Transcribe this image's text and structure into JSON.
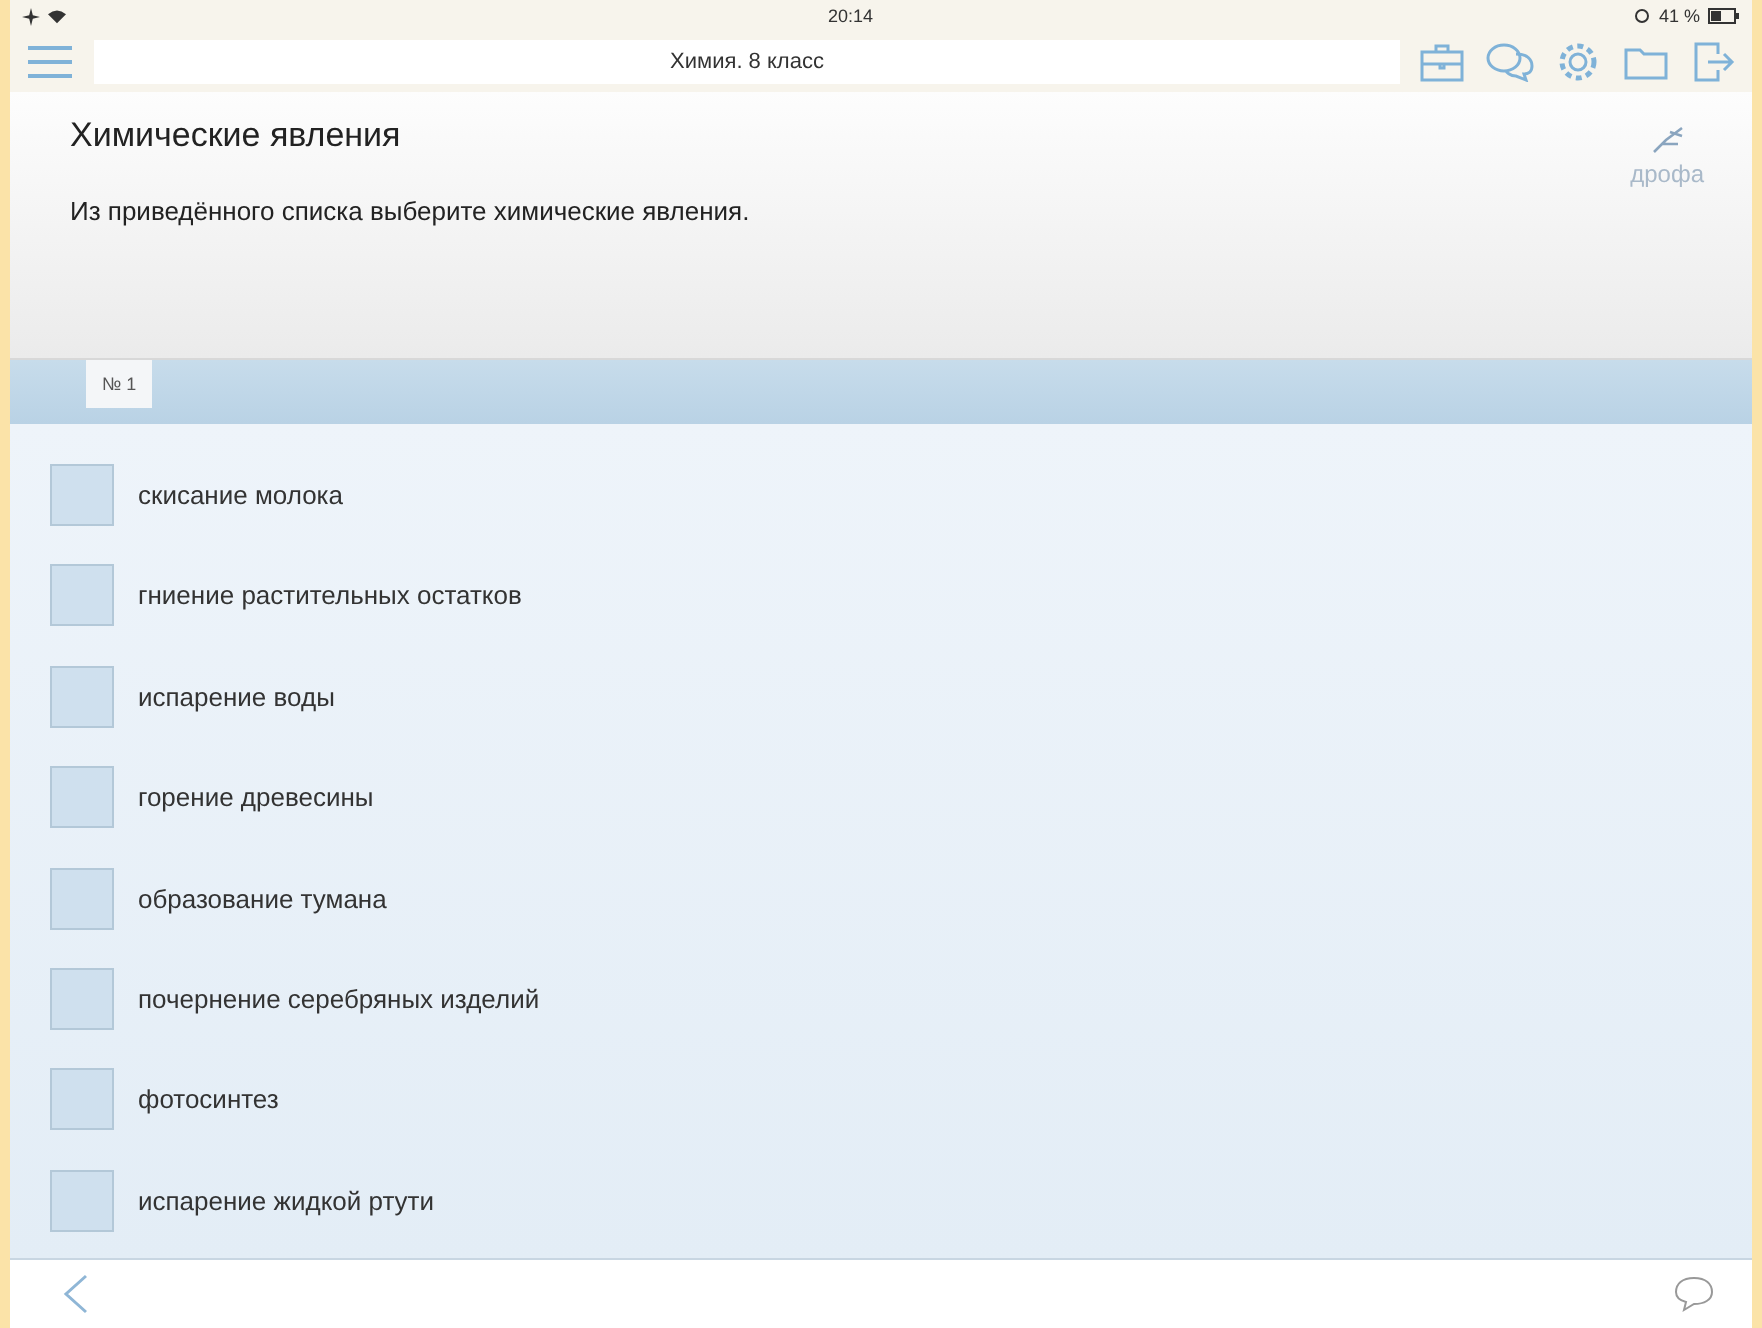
{
  "status_bar": {
    "time": "20:14",
    "battery": "41 %"
  },
  "nav_bar": {
    "title": "Химия. 8 класс"
  },
  "task": {
    "title": "Химические явления",
    "instruction": "Из приведённого списка выберите химические явления.",
    "logo_text": "дрофа"
  },
  "tabs": [
    {
      "label": "№ 1",
      "selected": true
    }
  ],
  "options": [
    {
      "label": "скисание молока",
      "checked": false
    },
    {
      "label": "гниение растительных остатков",
      "checked": false
    },
    {
      "label": "испарение воды",
      "checked": false
    },
    {
      "label": "горение древесины",
      "checked": false
    },
    {
      "label": "образование тумана",
      "checked": false
    },
    {
      "label": "почернение серебряных изделий",
      "checked": false
    },
    {
      "label": "фотосинтез",
      "checked": false
    },
    {
      "label": "испарение жидкой ртути",
      "checked": false
    }
  ]
}
